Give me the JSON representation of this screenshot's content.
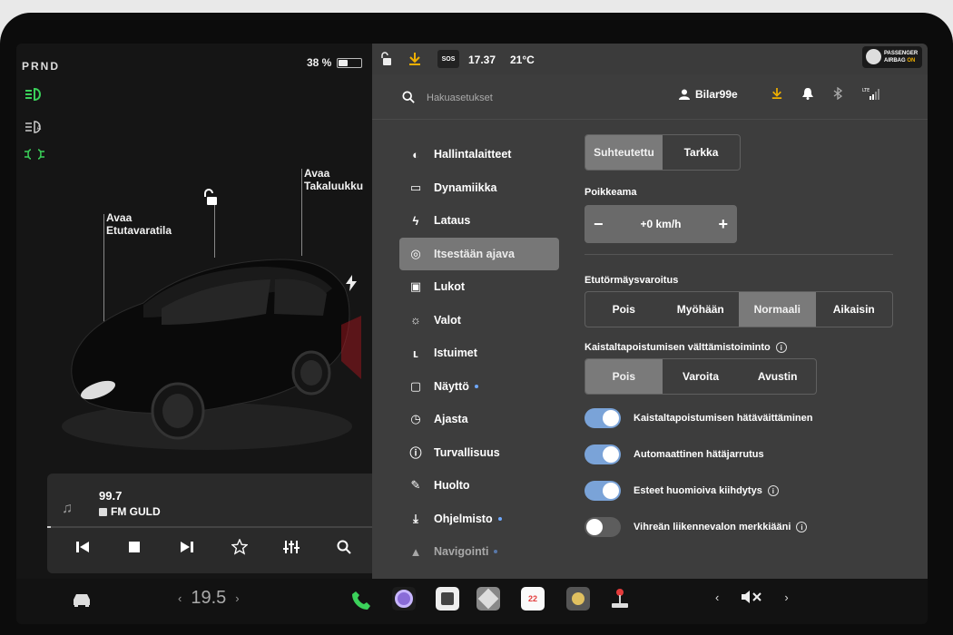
{
  "left": {
    "gear": "PRND",
    "battery_percent": "38 %",
    "battery_level": 0.38,
    "labels": {
      "frunk": "Avaa\nEtutavaratila",
      "trunk": "Avaa\nTakaluukku"
    },
    "media": {
      "frequency": "99.7",
      "station": "FM GULD"
    }
  },
  "status": {
    "time": "17.37",
    "temperature": "21°C",
    "sos": "SOS",
    "airbag_line1": "PASSENGER",
    "airbag_line2": "AIRBAG",
    "airbag_state": "ON"
  },
  "search": {
    "placeholder": "Hakuasetukset"
  },
  "user": {
    "name": "Bilar99e"
  },
  "nav": [
    {
      "label": "Hallintalaitteet",
      "icon": "toggle-icon"
    },
    {
      "label": "Dynamiikka",
      "icon": "car-icon"
    },
    {
      "label": "Lataus",
      "icon": "bolt-icon"
    },
    {
      "label": "Itsestään ajava",
      "icon": "steering-wheel-icon",
      "active": true
    },
    {
      "label": "Lukot",
      "icon": "lock-icon"
    },
    {
      "label": "Valot",
      "icon": "sun-icon"
    },
    {
      "label": "Istuimet",
      "icon": "seat-icon"
    },
    {
      "label": "Näyttö",
      "icon": "display-icon",
      "dot": true
    },
    {
      "label": "Ajasta",
      "icon": "alarm-icon"
    },
    {
      "label": "Turvallisuus",
      "icon": "info-circle-icon"
    },
    {
      "label": "Huolto",
      "icon": "wrench-icon"
    },
    {
      "label": "Ohjelmisto",
      "icon": "download-icon",
      "dot": true
    },
    {
      "label": "Navigointi",
      "icon": "navigation-icon",
      "dot": true
    }
  ],
  "content": {
    "mode": {
      "options": [
        "Suhteutettu",
        "Tarkka"
      ],
      "selected": 0
    },
    "offset_label": "Poikkeama",
    "offset_value": "+0 km/h",
    "fcw_label": "Etutörmäysvaroitus",
    "fcw": {
      "options": [
        "Pois",
        "Myöhään",
        "Normaali",
        "Aikaisin"
      ],
      "selected": 2
    },
    "lane_label": "Kaistaltapoistumisen välttämistoiminto",
    "lane": {
      "options": [
        "Pois",
        "Varoita",
        "Avustin"
      ],
      "selected": 0
    },
    "toggles": [
      {
        "label": "Kaistaltapoistumisen hätäväittäminen",
        "on": true,
        "info": false
      },
      {
        "label": "Automaattinen hätäjarrutus",
        "on": true,
        "info": false
      },
      {
        "label": "Esteet huomioiva kiihdytys",
        "on": true,
        "info": true
      },
      {
        "label": "Vihreän liikennevalon merkkiääni",
        "on": false,
        "info": true
      }
    ]
  },
  "dock": {
    "temperature": "19.5",
    "calendar_day": "22",
    "colors": {
      "phone": "#3bd15a",
      "camera": "#8a6cd8",
      "calendar": "#e33b3b"
    }
  },
  "colors": {
    "accent_yellow": "#f0b000",
    "toggle_on": "#7aa3d8",
    "headlight_green": "#3bd15a"
  }
}
